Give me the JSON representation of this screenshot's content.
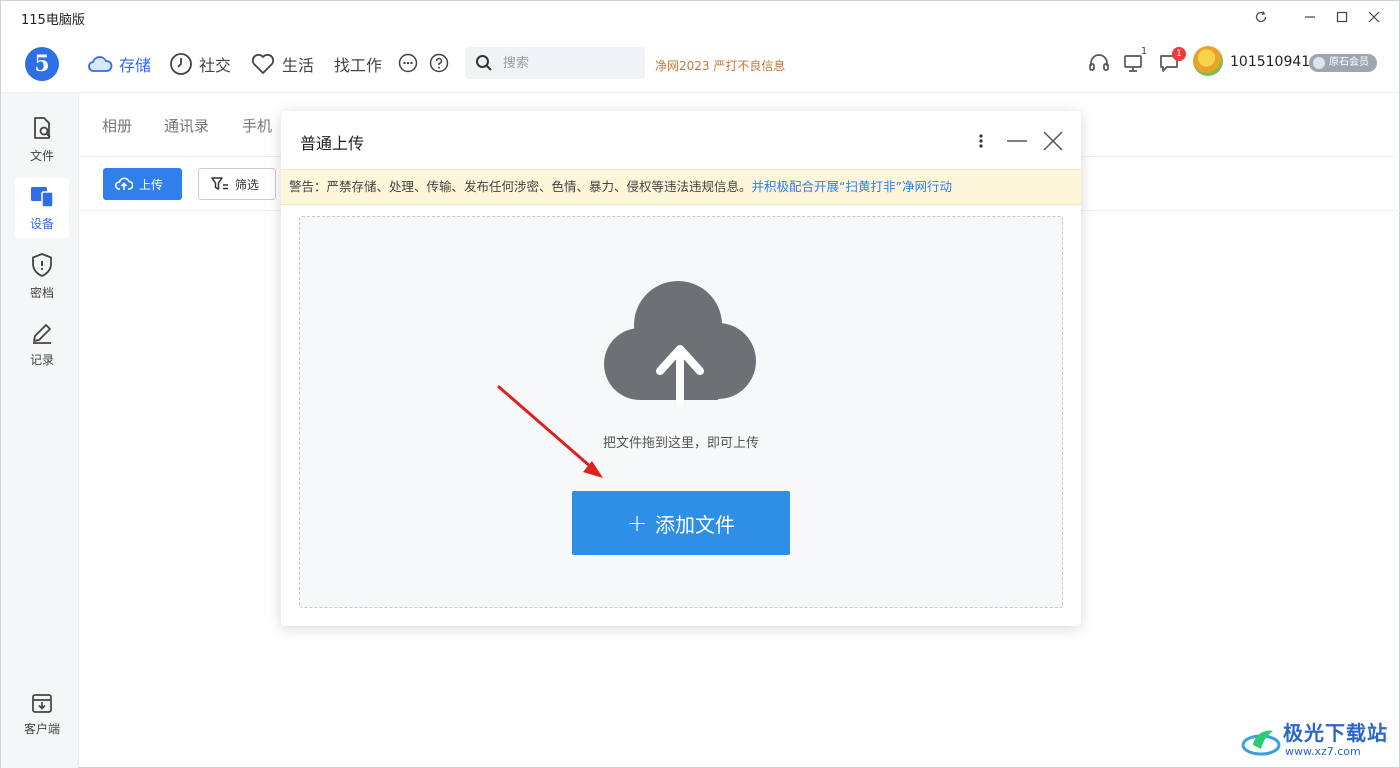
{
  "window": {
    "title": "115电脑版"
  },
  "nav": {
    "logo": "5",
    "items": [
      {
        "label": "存储",
        "icon": "cloud-icon",
        "active": true
      },
      {
        "label": "社交",
        "icon": "clock-icon",
        "active": false
      },
      {
        "label": "生活",
        "icon": "heart-icon",
        "active": false
      },
      {
        "label": "找工作",
        "icon": "",
        "active": false
      }
    ],
    "search_placeholder": "搜索",
    "promo": "净网2023 严打不良信息",
    "device_badge": "1",
    "message_badge": "1",
    "username": "101510941",
    "member_label": "原石会员"
  },
  "sidebar": {
    "items": [
      {
        "label": "文件",
        "icon": "file-search-icon"
      },
      {
        "label": "设备",
        "icon": "devices-icon",
        "active": true
      },
      {
        "label": "密档",
        "icon": "shield-icon"
      },
      {
        "label": "记录",
        "icon": "pencil-icon"
      }
    ],
    "client_label": "客户端"
  },
  "main": {
    "subtabs": [
      "相册",
      "通讯录",
      "手机"
    ],
    "upload_label": "上传",
    "filter_label": "筛选"
  },
  "modal": {
    "title": "普通上传",
    "warning_text": "警告：严禁存储、处理、传输、发布任何涉密、色情、暴力、侵权等违法违规信息。",
    "warning_link": "并积极配合开展“扫黄打非”净网行动",
    "drop_hint": "把文件拖到这里，即可上传",
    "add_button_label": "添加文件"
  },
  "watermark": {
    "main": "极光下载站",
    "sub": "www.xz7.com"
  },
  "colors": {
    "accent": "#2f80ed",
    "warning_bg": "#fdf6db",
    "badge_red": "#ee3a3a",
    "annotation_arrow": "#e02020"
  }
}
